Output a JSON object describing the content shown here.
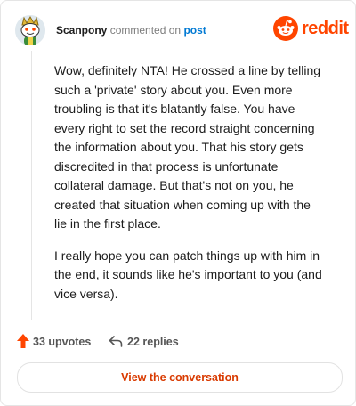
{
  "header": {
    "username": "Scanpony",
    "verb": "commented on",
    "post_link": "post",
    "brand": "reddit"
  },
  "comment": {
    "paragraphs": [
      "Wow, definitely NTA! He crossed a line by telling such a 'private' story about you. Even more troubling is that it's blatantly false. You have every right to set the record straight concerning the information about you. That his story gets discredited in that process is unfortunate collateral damage. But that's not on you, he created that situation when coming up with the lie in the first place.",
      "I really hope you can patch things up with him in the end, it sounds like he's important to you (and vice versa)."
    ]
  },
  "actions": {
    "upvotes": "33 upvotes",
    "replies": "22 replies"
  },
  "cta": {
    "label": "View the conversation"
  },
  "colors": {
    "brand": "#ff4500",
    "link": "#0079d3",
    "cta_text": "#d93a00"
  },
  "icons": {
    "avatar": "snoo-avatar-icon",
    "logo": "reddit-snoo-icon",
    "upvote": "upvote-arrow-icon",
    "reply": "reply-arrow-icon"
  }
}
